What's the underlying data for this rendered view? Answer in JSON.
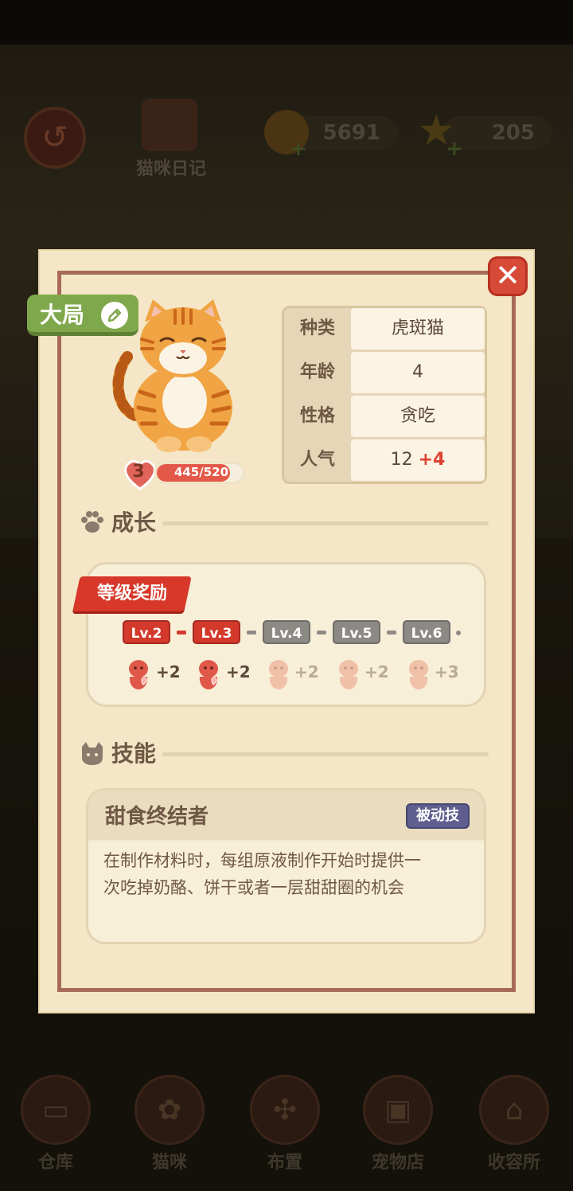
{
  "background": {
    "diary_label": "猫咪日记",
    "coins": "5691",
    "stars": "205",
    "nav": [
      "仓库",
      "猫咪",
      "布置",
      "宠物店",
      "收容所"
    ]
  },
  "cat": {
    "name": "大局",
    "level": "3",
    "xp_text": "445/520",
    "xp_fraction": 0.856
  },
  "info": {
    "rows": [
      {
        "label": "种类",
        "value": "虎斑猫"
      },
      {
        "label": "年龄",
        "value": "4"
      },
      {
        "label": "性格",
        "value": "贪吃"
      },
      {
        "label": "人气",
        "value": "12",
        "bonus": "+4"
      }
    ]
  },
  "growth": {
    "title": "成长",
    "reward_title": "等级奖励",
    "levels": [
      {
        "label": "Lv.2",
        "unlocked": true,
        "reward": "+2"
      },
      {
        "label": "Lv.3",
        "unlocked": true,
        "reward": "+2"
      },
      {
        "label": "Lv.4",
        "unlocked": false,
        "reward": "+2"
      },
      {
        "label": "Lv.5",
        "unlocked": false,
        "reward": "+2"
      },
      {
        "label": "Lv.6",
        "unlocked": false,
        "reward": "+3"
      }
    ]
  },
  "skills": {
    "title": "技能",
    "name": "甜食终结者",
    "tag": "被动技",
    "desc_line1": "在制作材料时，每组原液制作开始时提供一",
    "desc_line2": "次吃掉奶酪、饼干或者一层甜甜圈的机会"
  },
  "colors": {
    "panel": "#f4e6c6",
    "frame": "#a86a5a",
    "accent_red": "#d33a2c",
    "accent_green": "#7fa84c",
    "locked_gray": "#8d8a86",
    "passive_tag": "#5f5e8e"
  }
}
